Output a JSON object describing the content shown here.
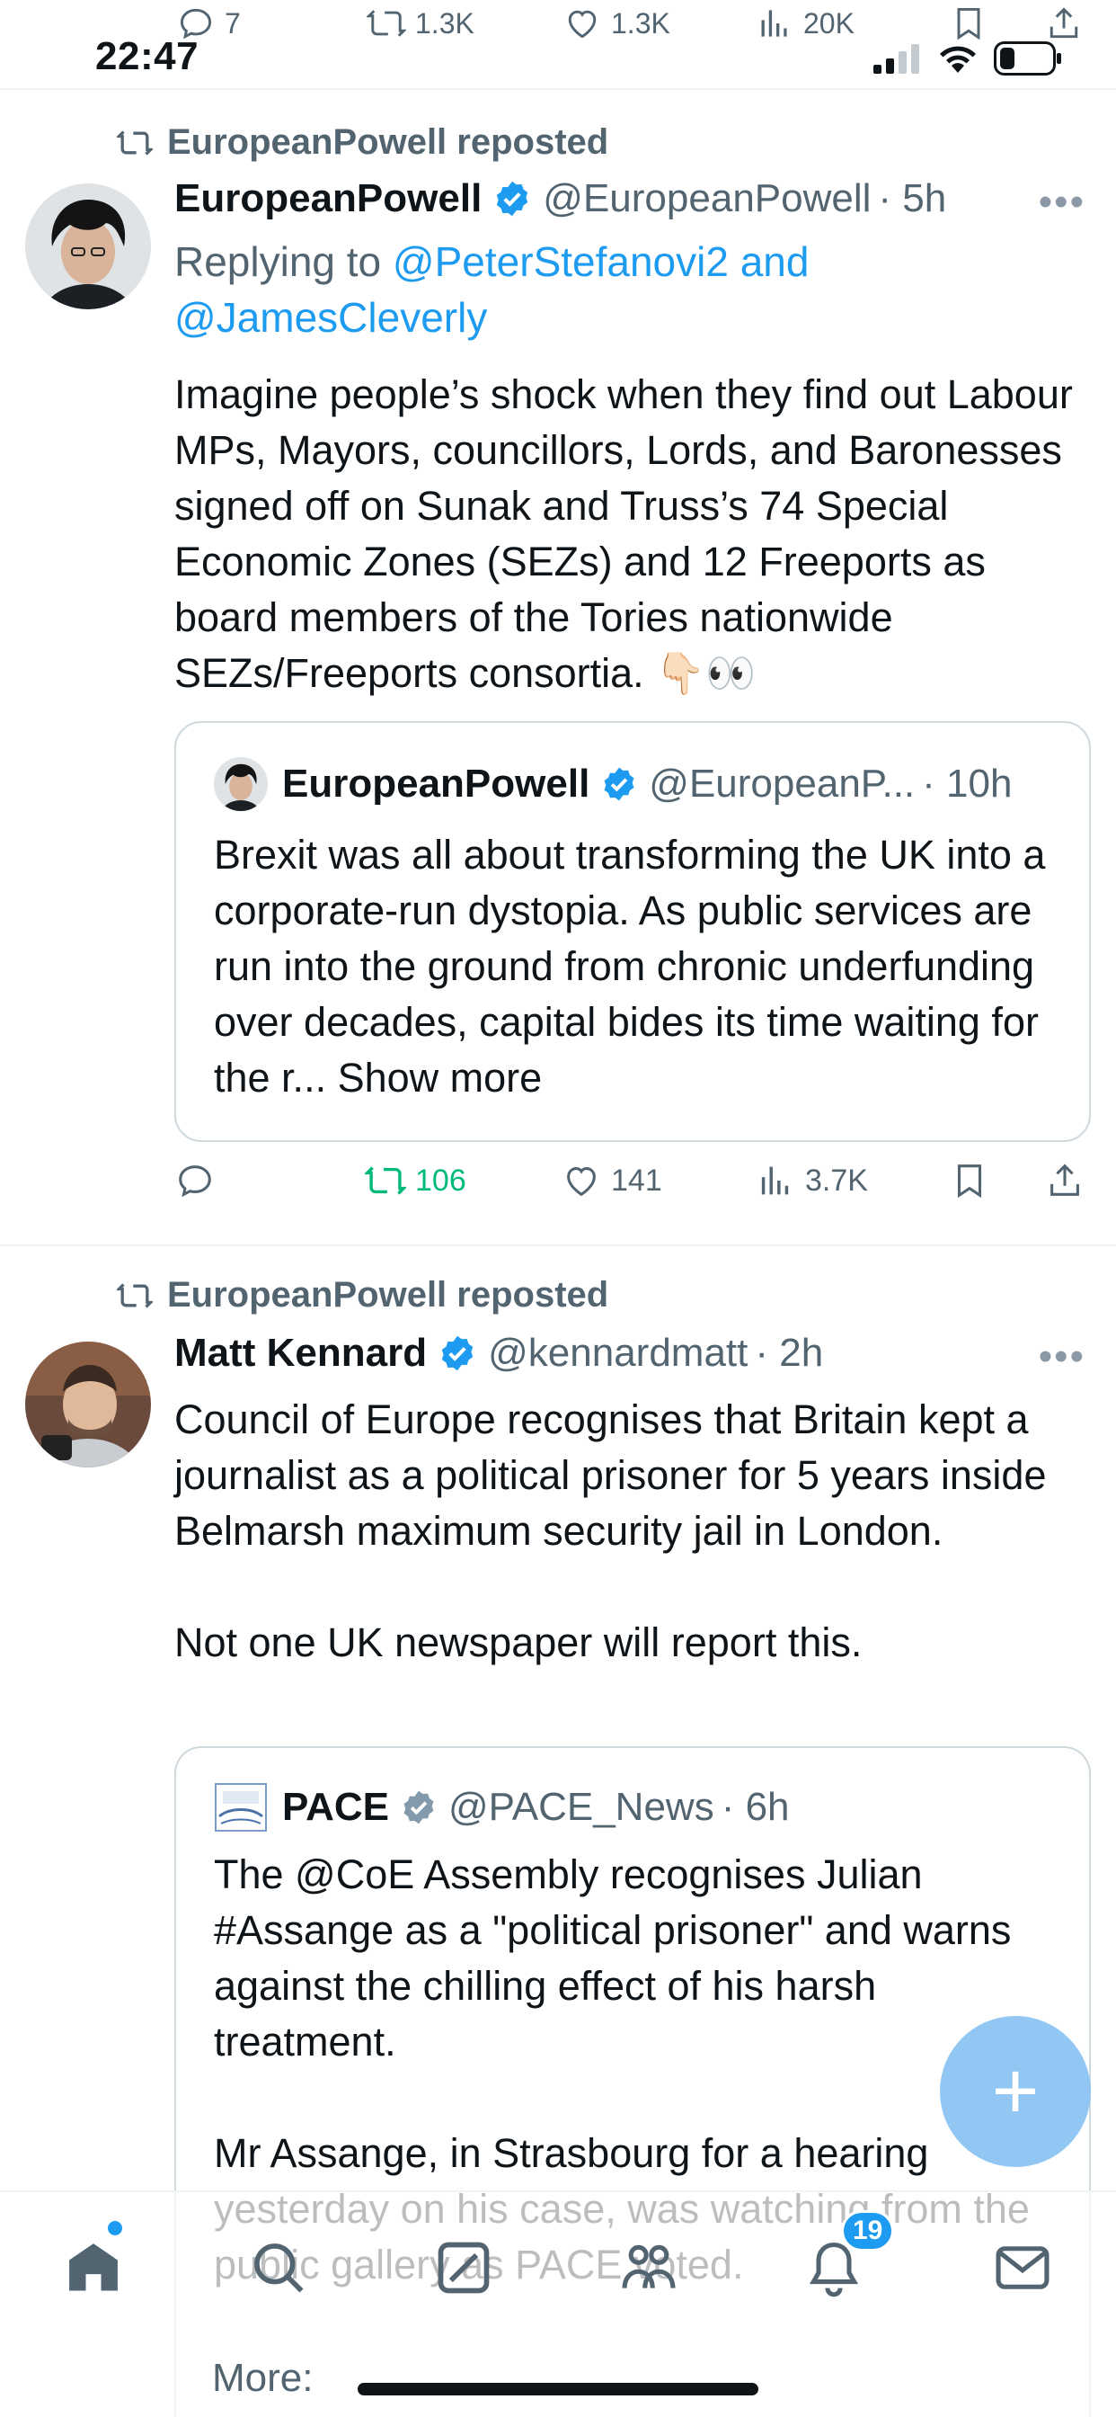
{
  "status_bar": {
    "time": "22:47"
  },
  "top_actions": {
    "replies": "7",
    "reposts": "1.3K",
    "likes": "1.3K",
    "views": "20K"
  },
  "post1": {
    "repost_label": "EuropeanPowell reposted",
    "name": "EuropeanPowell",
    "handle": "@EuropeanPowell",
    "time": "· 5h",
    "reply_prefix": "Replying to ",
    "reply_to": "@PeterStefanovi2 and @JamesCleverly",
    "text": "Imagine people’s shock when they find out Labour MPs, Mayors, councillors, Lords, and Baronesses signed off on Sunak and Truss’s 74 Special Economic Zones (SEZs) and 12 Freeports as board members of the Tories nationwide SEZs/Freeports consortia. 👇🏻👀",
    "quote": {
      "name": "EuropeanPowell",
      "handle": "@EuropeanP...",
      "time": "· 10h",
      "text": "Brexit was all about transforming the UK into a corporate-run dystopia. As public services are run into the ground from chronic underfunding over decades, capital bides its time waiting for the r... Show more"
    },
    "actions": {
      "reposts": "106",
      "likes": "141",
      "views": "3.7K"
    }
  },
  "post2": {
    "repost_label": "EuropeanPowell reposted",
    "name": "Matt Kennard",
    "handle": "@kennardmatt",
    "time": "· 2h",
    "text": "Council of Europe recognises that Britain kept a journalist as a political prisoner for 5 years inside Belmarsh maximum security jail in London.\n\nNot one UK newspaper will report this.",
    "quote": {
      "name": "PACE",
      "handle": "@PACE_News",
      "time": "· 6h",
      "text": "The @CoE Assembly recognises Julian #Assange as a \"political prisoner\" and warns against the chilling effect of his harsh treatment.\n\nMr Assange, in Strasbourg for a hearing yesterday on his case, was watching from the public gallery as PACE voted."
    }
  },
  "more_label": "More:",
  "nav": {
    "notifications_badge": "19"
  },
  "colors": {
    "accent": "#1d9bf0",
    "repost_green": "#00ba7c",
    "muted": "#536471"
  }
}
